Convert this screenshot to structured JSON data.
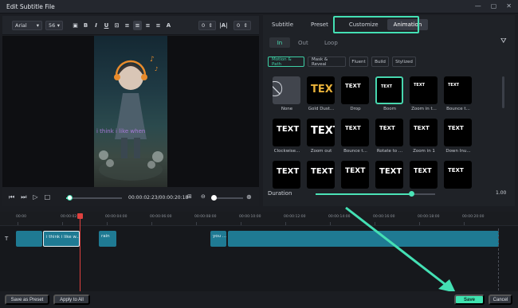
{
  "window": {
    "title": "Edit Subtitle File"
  },
  "format_bar": {
    "font": "Arial",
    "size": "56",
    "spacing_value": "0",
    "line_value": "0"
  },
  "video": {
    "caption": "i think i like when"
  },
  "playback": {
    "time": "00:00:02:23/00:00:20:18",
    "progress": 0.06
  },
  "tabs": {
    "subtitle": "Subtitle",
    "preset": "Preset",
    "customize": "Customize",
    "animation": "Animation"
  },
  "subtabs": {
    "in": "In",
    "out": "Out",
    "loop": "Loop"
  },
  "categories": [
    "Motion & Path",
    "Mask & Reveal",
    "Fluent",
    "Build",
    "Stylized"
  ],
  "effects": [
    {
      "label": "None",
      "preview": ""
    },
    {
      "label": "Gold Dust...",
      "preview": "TEX"
    },
    {
      "label": "Drop",
      "preview": "TEXT"
    },
    {
      "label": "Boom",
      "preview": "TEXT"
    },
    {
      "label": "Zoom in t...",
      "preview": "TEXT"
    },
    {
      "label": "Bounce t...",
      "preview": "TEXT"
    },
    {
      "label": "Clockwise...",
      "preview": "TEXT"
    },
    {
      "label": "Zoom out",
      "preview": "TEXT"
    },
    {
      "label": "Bounce t...",
      "preview": "TEXT"
    },
    {
      "label": "Rotate to ...",
      "preview": "TEXT"
    },
    {
      "label": "Zoom in 1",
      "preview": "TEXT"
    },
    {
      "label": "Down Inu...",
      "preview": "TEXT"
    },
    {
      "label": "",
      "preview": "TEXT"
    },
    {
      "label": "",
      "preview": "TEXT"
    },
    {
      "label": "",
      "preview": "TEXT"
    },
    {
      "label": "",
      "preview": "TEXT"
    },
    {
      "label": "",
      "preview": "TEXT"
    },
    {
      "label": "",
      "preview": "TEXT"
    }
  ],
  "duration": {
    "label": "Duration",
    "value": "1.00",
    "level": 0.8
  },
  "ruler": [
    "00:00",
    "00:00:02:00",
    "00:00:04:00",
    "00:00:06:00",
    "00:00:08:00",
    "00:00:10:00",
    "00:00:12:00",
    "00:00:14:00",
    "00:00:16:00",
    "00:00:18:00",
    "00:00:20:00"
  ],
  "clips": [
    {
      "text": ""
    },
    {
      "text": "i think i like w..."
    },
    {
      "text": "rain"
    },
    {
      "text": "you ..."
    },
    {
      "text": ""
    }
  ],
  "buttons": {
    "save_preset": "Save as Preset",
    "apply_all": "Apply to All",
    "save": "Save",
    "cancel": "Cancel"
  },
  "colors": {
    "accent": "#3fe3b0",
    "clip": "#1f7a93"
  }
}
